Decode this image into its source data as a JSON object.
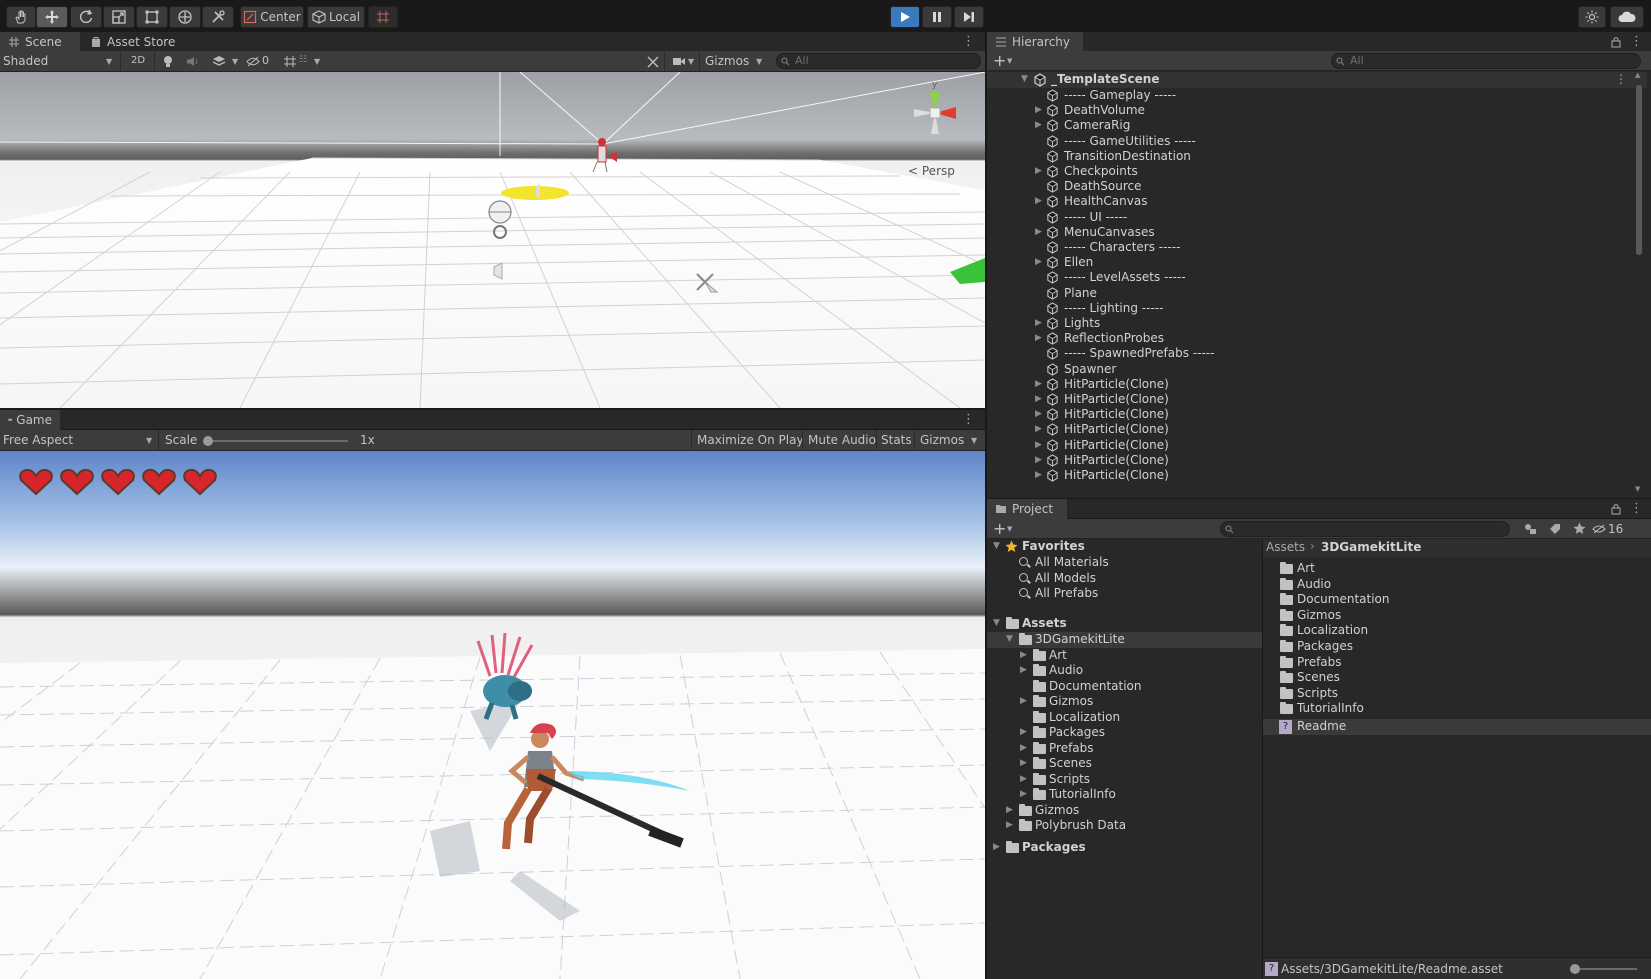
{
  "toolbar": {
    "pivot_center": "Center",
    "pivot_local": "Local",
    "tools": [
      "hand-tool",
      "move-tool",
      "rotate-tool",
      "scale-tool",
      "rect-tool",
      "transform-tool",
      "custom-tool"
    ]
  },
  "scene": {
    "tabs": [
      "Scene",
      "Asset Store"
    ],
    "shading": "Shaded",
    "mode_2d": "2D",
    "hidden_count": "0",
    "gizmos_label": "Gizmos",
    "search_placeholder": "All",
    "persp_label": "Persp",
    "axis_y": "y"
  },
  "game": {
    "tab": "Game",
    "aspect": "Free Aspect",
    "scale_label": "Scale",
    "scale_value": "1x",
    "maximize": "Maximize On Play",
    "mute": "Mute Audio",
    "stats": "Stats",
    "gizmos": "Gizmos",
    "hearts": 5
  },
  "hierarchy": {
    "tab": "Hierarchy",
    "search_placeholder": "All",
    "scene_name": "_TemplateScene",
    "items": [
      {
        "name": "----- Gameplay -----",
        "expandable": false
      },
      {
        "name": "DeathVolume",
        "expandable": true
      },
      {
        "name": "CameraRig",
        "expandable": true
      },
      {
        "name": "----- GameUtilities -----",
        "expandable": false
      },
      {
        "name": "TransitionDestination",
        "expandable": false
      },
      {
        "name": "Checkpoints",
        "expandable": true
      },
      {
        "name": "DeathSource",
        "expandable": false
      },
      {
        "name": "HealthCanvas",
        "expandable": true
      },
      {
        "name": "----- UI -----",
        "expandable": false
      },
      {
        "name": "MenuCanvases",
        "expandable": true
      },
      {
        "name": "----- Characters -----",
        "expandable": false
      },
      {
        "name": "Ellen",
        "expandable": true
      },
      {
        "name": "----- LevelAssets -----",
        "expandable": false
      },
      {
        "name": "Plane",
        "expandable": false
      },
      {
        "name": "----- Lighting -----",
        "expandable": false
      },
      {
        "name": "Lights",
        "expandable": true
      },
      {
        "name": "ReflectionProbes",
        "expandable": true
      },
      {
        "name": "----- SpawnedPrefabs -----",
        "expandable": false
      },
      {
        "name": "Spawner",
        "expandable": false
      },
      {
        "name": "HitParticle(Clone)",
        "expandable": true
      },
      {
        "name": "HitParticle(Clone)",
        "expandable": true
      },
      {
        "name": "HitParticle(Clone)",
        "expandable": true
      },
      {
        "name": "HitParticle(Clone)",
        "expandable": true
      },
      {
        "name": "HitParticle(Clone)",
        "expandable": true
      },
      {
        "name": "HitParticle(Clone)",
        "expandable": true
      },
      {
        "name": "HitParticle(Clone)",
        "expandable": true
      }
    ]
  },
  "project": {
    "tab": "Project",
    "hidden_count": "16",
    "favorites_label": "Favorites",
    "favorites": [
      "All Materials",
      "All Models",
      "All Prefabs"
    ],
    "assets_label": "Assets",
    "tree": [
      {
        "name": "3DGamekitLite",
        "depth": 1,
        "expandable": true,
        "expanded": true,
        "selected": true
      },
      {
        "name": "Art",
        "depth": 2,
        "expandable": true
      },
      {
        "name": "Audio",
        "depth": 2,
        "expandable": true
      },
      {
        "name": "Documentation",
        "depth": 2,
        "expandable": false
      },
      {
        "name": "Gizmos",
        "depth": 2,
        "expandable": true
      },
      {
        "name": "Localization",
        "depth": 2,
        "expandable": false
      },
      {
        "name": "Packages",
        "depth": 2,
        "expandable": true
      },
      {
        "name": "Prefabs",
        "depth": 2,
        "expandable": true
      },
      {
        "name": "Scenes",
        "depth": 2,
        "expandable": true
      },
      {
        "name": "Scripts",
        "depth": 2,
        "expandable": true
      },
      {
        "name": "TutorialInfo",
        "depth": 2,
        "expandable": true
      },
      {
        "name": "Gizmos",
        "depth": 1,
        "expandable": true
      },
      {
        "name": "Polybrush Data",
        "depth": 1,
        "expandable": true
      }
    ],
    "packages_label": "Packages",
    "breadcrumb": [
      "Assets",
      "3DGamekitLite"
    ],
    "contents": [
      "Art",
      "Audio",
      "Documentation",
      "Gizmos",
      "Localization",
      "Packages",
      "Prefabs",
      "Scenes",
      "Scripts",
      "TutorialInfo"
    ],
    "readme": "Readme",
    "status_path": "Assets/3DGamekitLite/Readme.asset"
  },
  "colors": {
    "play_blue": "#3a79bb",
    "heart_red": "#d8242b",
    "selection": "#3a3a3a"
  }
}
